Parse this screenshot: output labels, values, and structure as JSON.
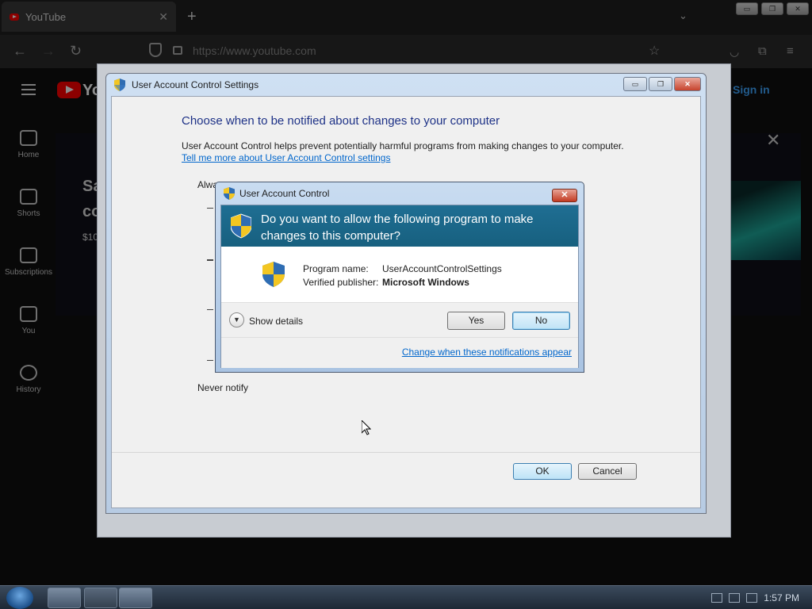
{
  "browser": {
    "tab_title": "YouTube",
    "new_tab": "+",
    "tab_close": "✕",
    "tab_list": "⌄",
    "window_controls": [
      "▭",
      "❐",
      "✕"
    ],
    "nav": {
      "back": "←",
      "forward": "→",
      "reload": "↻"
    },
    "url": "https://www.youtube.com",
    "toolbar_icons": [
      "star-icon",
      "pocket-icon",
      "extensions-icon",
      "menu-icon"
    ]
  },
  "youtube": {
    "logo_text": "Yo",
    "sign_in": "Sign in",
    "sidebar": [
      {
        "label": "Home",
        "icon": "home-icon"
      },
      {
        "label": "Shorts",
        "icon": "shorts-icon"
      },
      {
        "label": "Subscriptions",
        "icon": "subscriptions-icon"
      },
      {
        "label": "You",
        "icon": "you-icon"
      },
      {
        "label": "History",
        "icon": "history-icon"
      }
    ],
    "banner_line1": "Sa",
    "banner_line2": "co",
    "banner_price": "$10",
    "banner_close": "✕"
  },
  "uac_settings": {
    "title": "User Account Control Settings",
    "window_controls": [
      "▭",
      "❐",
      "✕"
    ],
    "heading": "Choose when to be notified about changes to your computer",
    "description": "User Account Control helps prevent potentially harmful programs from making changes to your computer.",
    "learn_more_link": "Tell me more about User Account Control settings",
    "always_notify": "Alwa",
    "never_notify": "Never notify",
    "ok_button": "OK",
    "cancel_button": "Cancel"
  },
  "uac_prompt": {
    "title": "User Account Control",
    "close": "✕",
    "question": "Do you want to allow the following program to make changes to this computer?",
    "program_name_label": "Program name:",
    "program_name_value": "UserAccountControlSettings",
    "publisher_label": "Verified publisher:",
    "publisher_value": "Microsoft Windows",
    "show_details": "Show details",
    "yes_button": "Yes",
    "no_button": "No",
    "change_link": "Change when these notifications appear"
  },
  "taskbar": {
    "clock": "1:57 PM"
  },
  "colors": {
    "uac_header": "#1f6e93",
    "link": "#0066cc",
    "heading": "#1e3287"
  }
}
